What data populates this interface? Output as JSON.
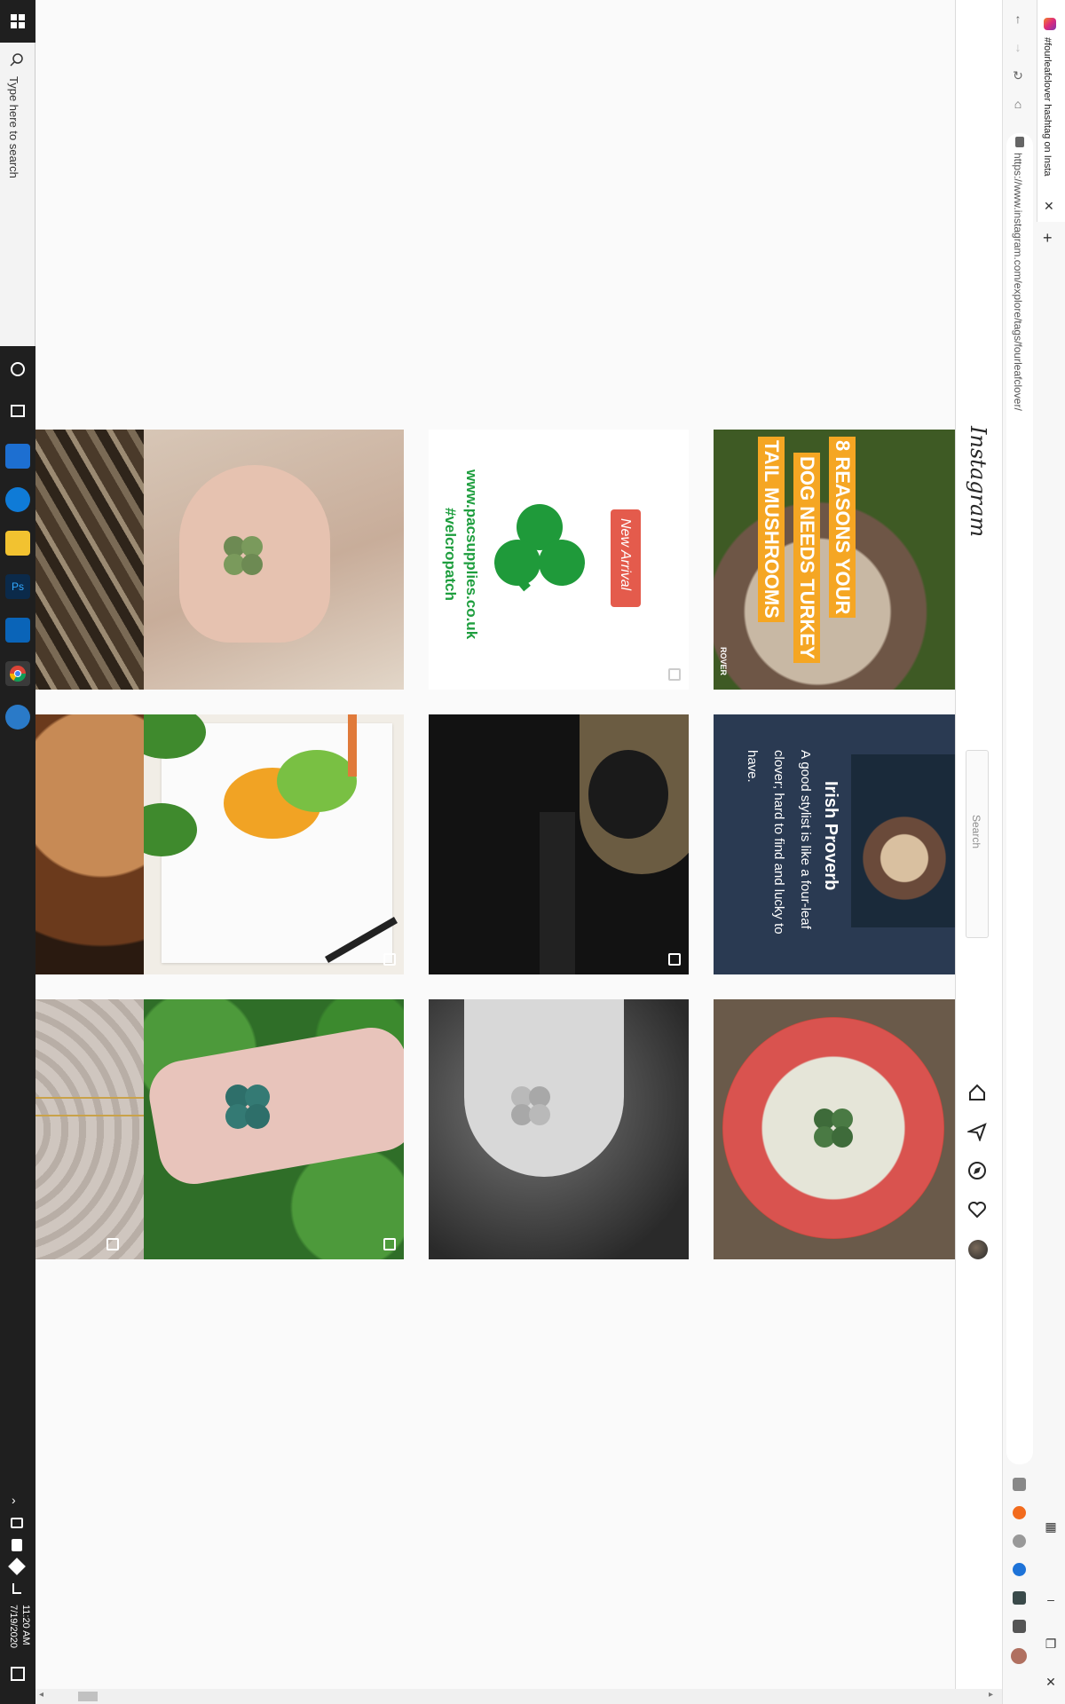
{
  "taskbar": {
    "search_placeholder": "Type here to search",
    "clock_time": "11:20 AM",
    "clock_date": "7/19/2020"
  },
  "browser": {
    "tab_title": "#fourleafclover hashtag on Insta",
    "url": "https://www.instagram.com/explore/tags/fourleafclover/"
  },
  "instagram": {
    "logo": "Instagram",
    "search_placeholder": "Search"
  },
  "tiles": {
    "pacs": {
      "tag": "New Arrival",
      "url": "www.pacsupplies.co.uk",
      "hashtag": "#velcropatch"
    },
    "mushroom": {
      "lines": [
        "8 REASONS YOUR",
        "DOG NEEDS TURKEY",
        "TAIL MUSHROOMS"
      ],
      "brand": "ROVER"
    },
    "proverb": {
      "title": "Irish Proverb",
      "body": "A good stylist is like a four-leaf clover; hard to find and lucky to have."
    }
  },
  "colors": {
    "accent_green": "#1e9e3e",
    "proverb_bg": "#2a3a52",
    "mushroom_text_bg": "#f5a623"
  }
}
